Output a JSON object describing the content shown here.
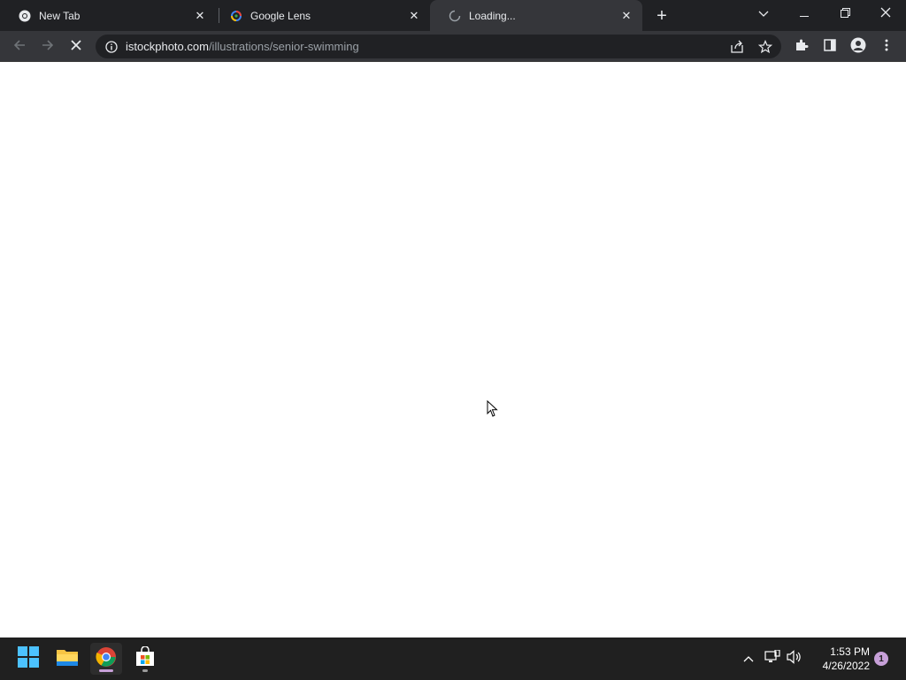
{
  "browser": {
    "tabs": [
      {
        "title": "New Tab",
        "favicon": "chrome-icon",
        "close": "✕"
      },
      {
        "title": "Google Lens",
        "favicon": "google-lens-icon",
        "close": "✕"
      },
      {
        "title": "Loading...",
        "favicon": "loading-spinner-icon",
        "close": "✕",
        "active": true
      }
    ],
    "new_tab_label": "+",
    "address": {
      "host": "istockphoto.com",
      "path": "/illustrations/senior-swimming"
    }
  },
  "taskbar": {
    "time": "1:53 PM",
    "date": "4/26/2022",
    "notification_count": "1"
  },
  "colors": {
    "tabbar_bg": "#202124",
    "toolbar_bg": "#35363a",
    "taskbar_bg": "#202020",
    "notification_badge": "#c7a0d8"
  }
}
